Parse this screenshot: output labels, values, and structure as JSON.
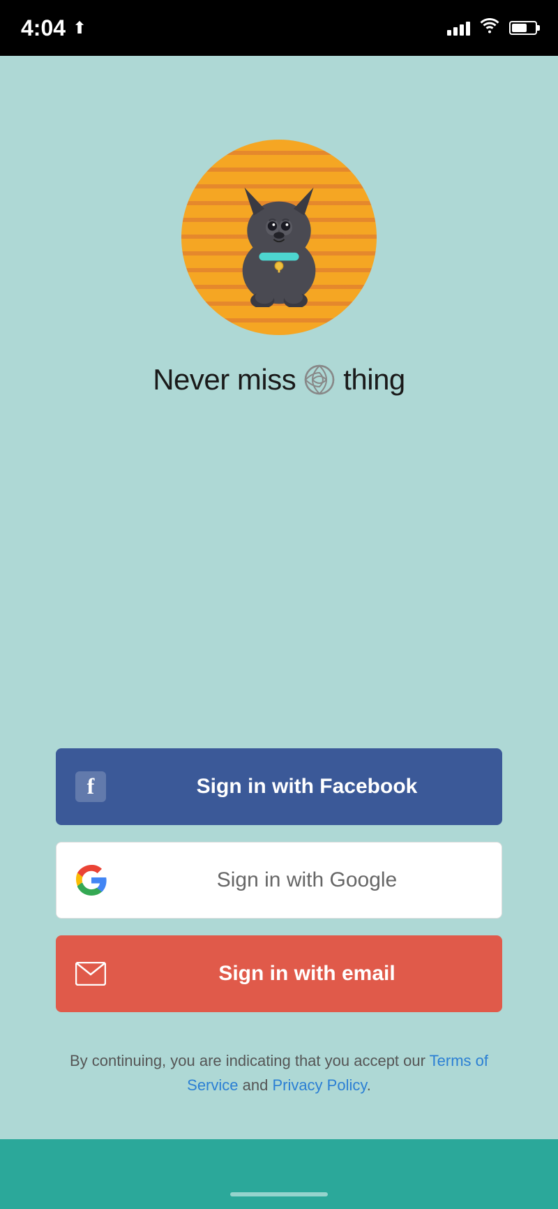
{
  "statusBar": {
    "time": "4:04",
    "location": "↗"
  },
  "tagline": {
    "prefix": "Never miss",
    "suffix": "thing"
  },
  "buttons": {
    "facebook": "Sign in with Facebook",
    "google": "Sign in with Google",
    "email": "Sign in with email"
  },
  "terms": {
    "prefix": "By continuing, you are indicating that you accept our ",
    "tos": "Terms of Service",
    "conjunction": " and ",
    "privacy": "Privacy Policy",
    "suffix": "."
  },
  "colors": {
    "background": "#aed8d5",
    "facebook": "#3b5998",
    "google_bg": "#ffffff",
    "email": "#e05a4a",
    "bottom_bar": "#2ba89a"
  }
}
